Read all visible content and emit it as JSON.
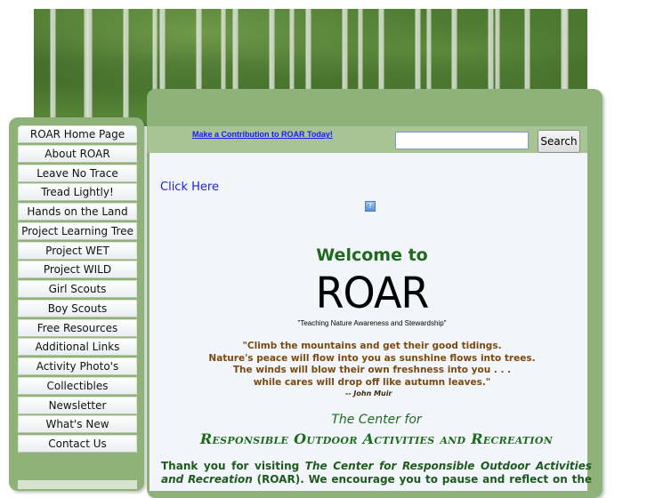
{
  "header": {
    "contribution_link": "Make a Contribution to ROAR Today!",
    "search_button": "Search",
    "search_placeholder": ""
  },
  "sidebar": {
    "items": [
      "ROAR Home Page",
      "About ROAR",
      "Leave No Trace",
      "Tread Lightly!",
      "Hands on the Land",
      "Project Learning Tree",
      "Project WET",
      "Project WILD",
      "Girl Scouts",
      "Boy Scouts",
      "Free Resources",
      "Additional Links",
      "Activity Photo's",
      "Collectibles",
      "Newsletter",
      "What's New",
      "Contact Us"
    ]
  },
  "main": {
    "click_here": "Click Here",
    "welcome": "Welcome to",
    "logo_text": "ROAR",
    "tagline": "\"Teaching Nature Awareness and Stewardship\"",
    "quote_lines": [
      "\"Climb the mountains and get their good tidings.",
      "Nature's peace will flow into you as sunshine flows into trees.",
      "The winds will blow their own freshness into you . . .",
      "while cares will drop off like autumn leaves.\""
    ],
    "quote_author": "-- John Muir",
    "center_for": "The Center for",
    "org_name": "Responsible Outdoor Activities and Recreation",
    "intro_start": "Thank you for visiting ",
    "intro_italic": "The Center for Responsible Outdoor Activities and Recreation",
    "intro_end": " (ROAR). We encourage you to pause and reflect on the"
  },
  "colors": {
    "frame_green": "#8fb27a",
    "heading_green": "#1e6b1e",
    "quote_brown": "#7a4a10",
    "link_blue": "#2222cc"
  }
}
